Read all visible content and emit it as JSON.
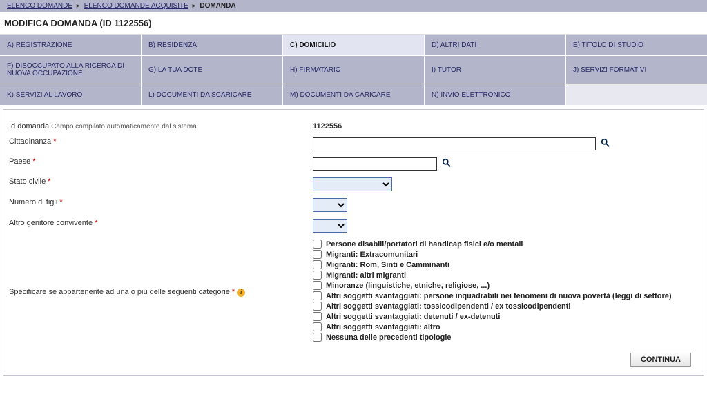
{
  "breadcrumb": {
    "item0": "ELENCO DOMANDE",
    "item1": "ELENCO DOMANDE ACQUISITE",
    "current": "DOMANDA"
  },
  "page_title": "MODIFICA DOMANDA (ID 1122556)",
  "tabs": {
    "a": "A) REGISTRAZIONE",
    "b": "B) RESIDENZA",
    "c": "C) DOMICILIO",
    "d": "D) ALTRI DATI",
    "e": "E) TITOLO DI STUDIO",
    "f": "F) DISOCCUPATO ALLA RICERCA DI NUOVA OCCUPAZIONE",
    "g": "G) LA TUA DOTE",
    "h": "H) FIRMATARIO",
    "i": "I) TUTOR",
    "j": "J) SERVIZI FORMATIVI",
    "k": "K) SERVIZI AL LAVORO",
    "l": "L) DOCUMENTI DA SCARICARE",
    "m": "M) DOCUMENTI DA CARICARE",
    "n": "N) INVIO ELETTRONICO"
  },
  "form": {
    "id_domanda_label": "Id domanda",
    "id_domanda_hint": "Campo compilato automaticamente dal sistema",
    "id_domanda_value": "1122556",
    "cittadinanza_label": "Cittadinanza",
    "cittadinanza_value": "",
    "paese_label": "Paese",
    "paese_value": "",
    "stato_civile_label": "Stato civile",
    "numero_figli_label": "Numero di figli",
    "altro_genitore_label": "Altro genitore convivente",
    "categorie_label": "Specificare se appartenente ad una o più delle seguenti categorie",
    "categorie": [
      "Persone disabili/portatori di handicap fisici e/o mentali",
      "Migranti: Extracomunitari",
      "Migranti: Rom, Sinti e Camminanti",
      "Migranti: altri migranti",
      "Minoranze (linguistiche, etniche, religiose, ...)",
      "Altri soggetti svantaggiati: persone inquadrabili nei fenomeni di nuova povertà (leggi di settore)",
      "Altri soggetti svantaggiati: tossicodipendenti / ex tossicodipendenti",
      "Altri soggetti svantaggiati: detenuti / ex-detenuti",
      "Altri soggetti svantaggiati: altro",
      "Nessuna delle precedenti tipologie"
    ]
  },
  "buttons": {
    "continua": "CONTINUA"
  }
}
